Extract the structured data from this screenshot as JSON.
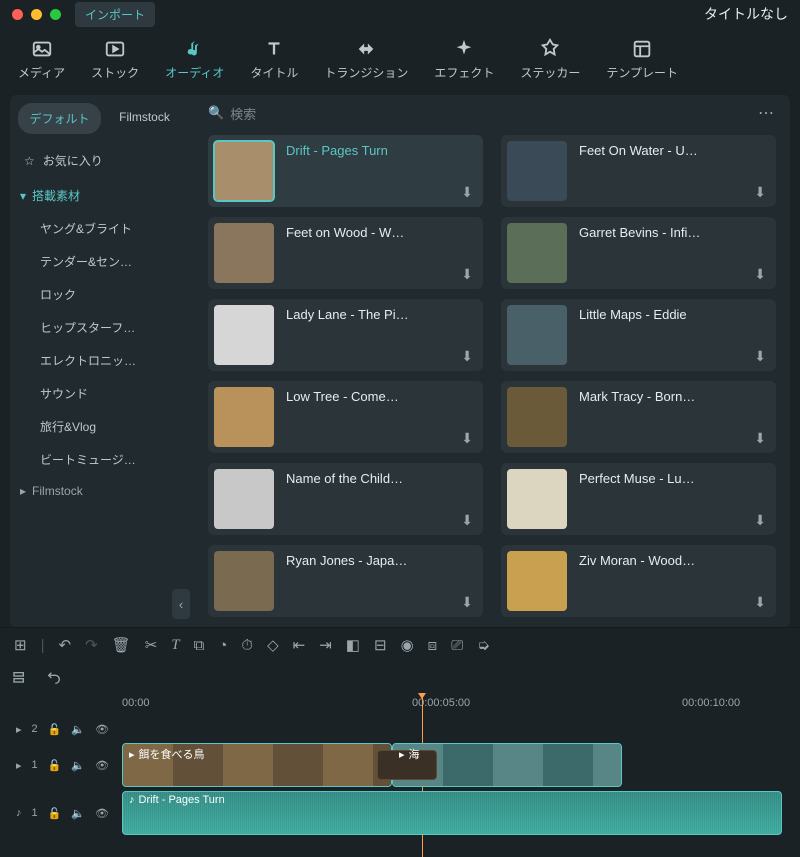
{
  "titlebar": {
    "import": "インポート",
    "title": "タイトルなし"
  },
  "toolbar": {
    "items": [
      {
        "label": "メディア"
      },
      {
        "label": "ストック"
      },
      {
        "label": "オーディオ"
      },
      {
        "label": "タイトル"
      },
      {
        "label": "トランジション"
      },
      {
        "label": "エフェクト"
      },
      {
        "label": "ステッカー"
      },
      {
        "label": "テンプレート"
      }
    ]
  },
  "sidebar": {
    "tabs": {
      "default": "デフォルト",
      "filmstock": "Filmstock"
    },
    "favorites": "お気に入り",
    "category_head": "搭載素材",
    "items": [
      "ヤング&ブライト",
      "テンダー&セン…",
      "ロック",
      "ヒップスターフ…",
      "エレクトロニッ…",
      "サウンド",
      "旅行&Vlog",
      "ビートミュージ…"
    ],
    "more_group": "Filmstock"
  },
  "search": {
    "placeholder": "検索"
  },
  "audio_items": [
    {
      "title": "Drift - Pages Turn",
      "thumb": "#a88e6a",
      "selected": true
    },
    {
      "title": "Feet On Water - U…",
      "thumb": "#3a4a56"
    },
    {
      "title": "Feet on Wood - W…",
      "thumb": "#8a765c"
    },
    {
      "title": "Garret Bevins - Infi…",
      "thumb": "#5a6e58"
    },
    {
      "title": "Lady Lane - The Pi…",
      "thumb": "#d6d6d6"
    },
    {
      "title": "Little Maps - Eddie",
      "thumb": "#4a6068"
    },
    {
      "title": "Low Tree - Come…",
      "thumb": "#b8925a"
    },
    {
      "title": "Mark Tracy - Born…",
      "thumb": "#6a5a3a"
    },
    {
      "title": "Name of the Child…",
      "thumb": "#c8c8c8"
    },
    {
      "title": "Perfect Muse - Lu…",
      "thumb": "#dcd6c0"
    },
    {
      "title": "Ryan Jones - Japa…",
      "thumb": "#7a6a50"
    },
    {
      "title": "Ziv Moran - Wood…",
      "thumb": "#c8a050"
    }
  ],
  "ruler": {
    "t0": "00:00",
    "t1": "00:00:05:00",
    "t2": "00:00:10:00"
  },
  "tracks": {
    "v2": "2",
    "v1": "1",
    "a1": "1",
    "clip1": "餌を食べる鳥",
    "clip2": "海",
    "audio_clip": "Drift - Pages Turn"
  }
}
